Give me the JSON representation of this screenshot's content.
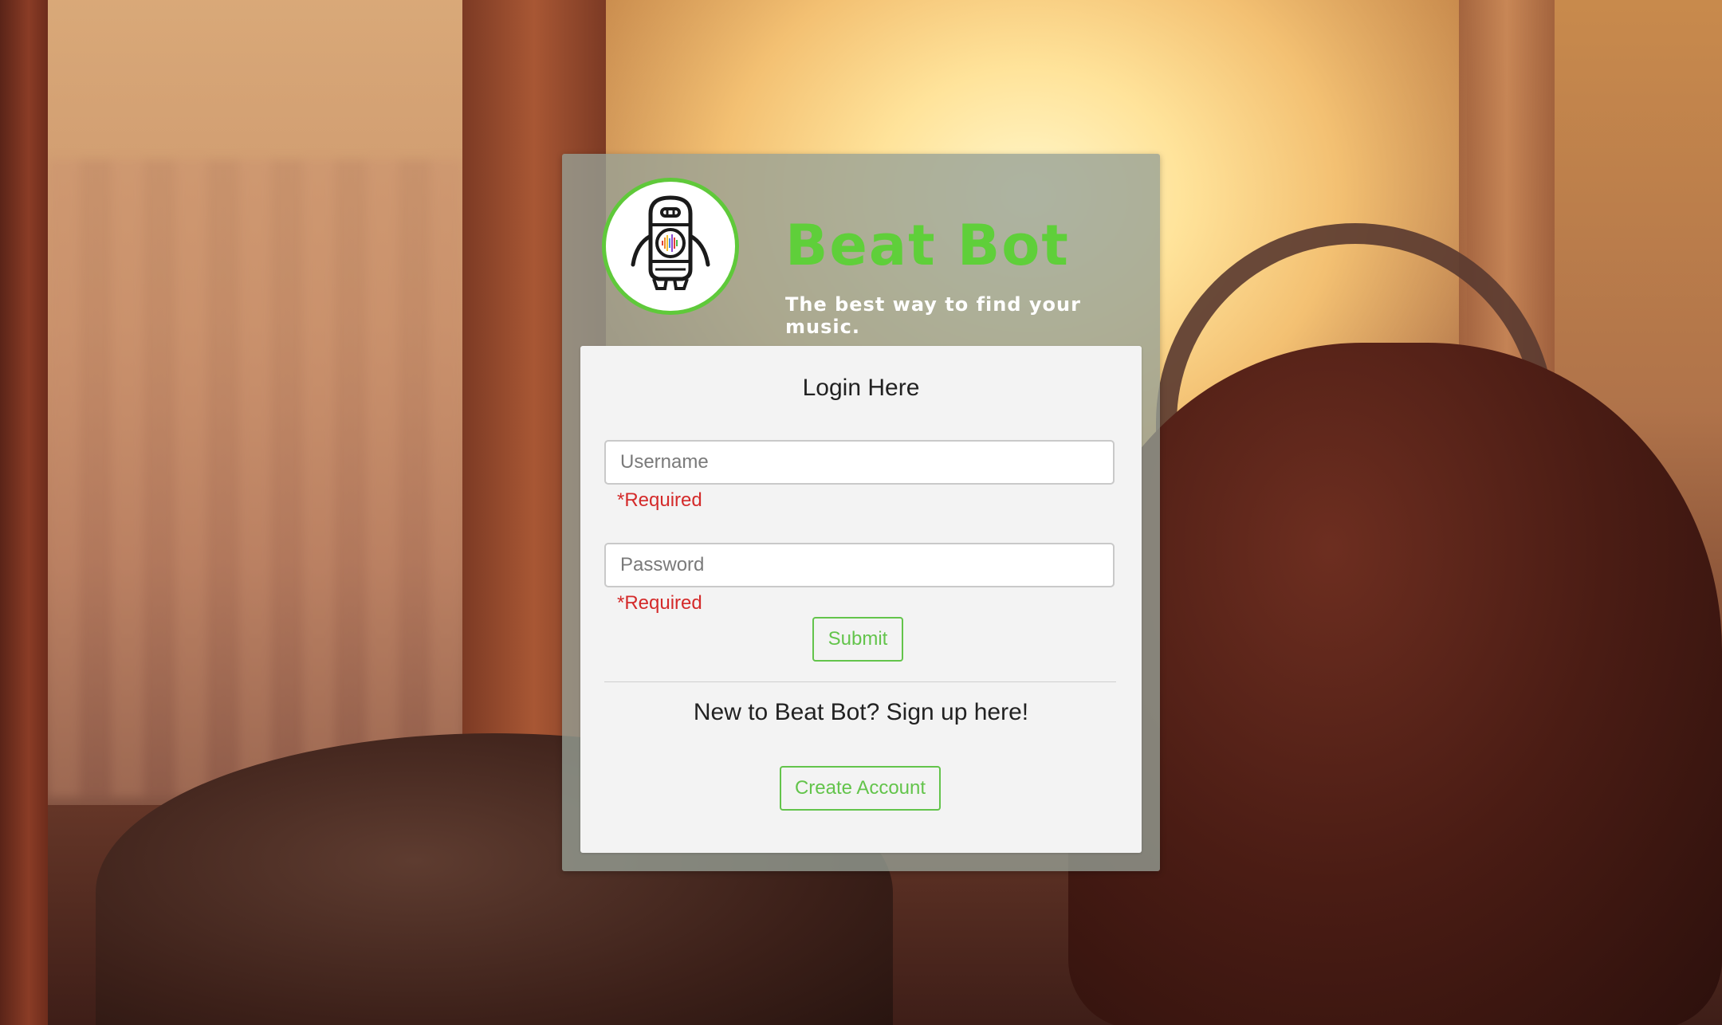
{
  "brand": {
    "title": "Beat Bot",
    "tagline": "The best way to find your music."
  },
  "login": {
    "heading": "Login Here",
    "username_placeholder": "Username",
    "username_value": "",
    "password_placeholder": "Password",
    "password_value": "",
    "username_error": "*Required",
    "password_error": "*Required",
    "submit_label": "Submit"
  },
  "signup": {
    "prompt": "New to Beat Bot? Sign up here!",
    "create_label": "Create Account"
  },
  "colors": {
    "accent": "#63c44b",
    "error": "#d42a2a",
    "panel": "rgba(150,160,150,0.78)",
    "card": "#f3f3f3"
  },
  "icons": {
    "logo": "robot-logo-icon"
  }
}
